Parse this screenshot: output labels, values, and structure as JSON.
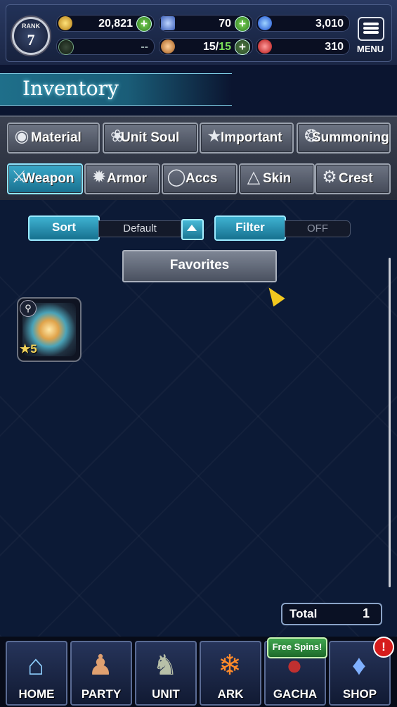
{
  "header": {
    "rank_label": "RANK",
    "rank_value": "7",
    "gil": "20,821",
    "crystals": "70",
    "blue_orb": "3,010",
    "stamina": "--",
    "units": "15",
    "units_max": "15",
    "red_orb": "310",
    "menu_label": "MENU"
  },
  "page_title": "Inventory",
  "tabs_row1": [
    {
      "label": "Material",
      "icon": "bag-icon"
    },
    {
      "label": "Unit Soul",
      "icon": "soul-icon"
    },
    {
      "label": "Important",
      "icon": "star-icon"
    },
    {
      "label": "Summoning",
      "icon": "summon-icon"
    }
  ],
  "tabs_row2": [
    {
      "label": "Weapon",
      "icon": "sword-icon",
      "active": true
    },
    {
      "label": "Armor",
      "icon": "armor-icon"
    },
    {
      "label": "Accs",
      "icon": "ring-icon"
    },
    {
      "label": "Skin",
      "icon": "hanger-icon"
    },
    {
      "label": "Crest",
      "icon": "crest-icon"
    }
  ],
  "controls": {
    "sort_label": "Sort",
    "sort_value": "Default",
    "filter_label": "Filter",
    "filter_value": "OFF",
    "favorites_label": "Favorites"
  },
  "items": [
    {
      "rarity": "5",
      "icon": "weapon-burst-icon"
    }
  ],
  "total": {
    "label": "Total",
    "value": "1"
  },
  "nav": {
    "home": "HOME",
    "party": "PARTY",
    "unit": "UNIT",
    "ark": "ARK",
    "gacha": "GACHA",
    "shop": "SHOP",
    "free_spins": "Free Spins!",
    "shop_badge": "!"
  },
  "colors": {
    "accent_cyan": "#3fb2d2",
    "background": "#0c1a36",
    "gold": "#f2d35a"
  }
}
